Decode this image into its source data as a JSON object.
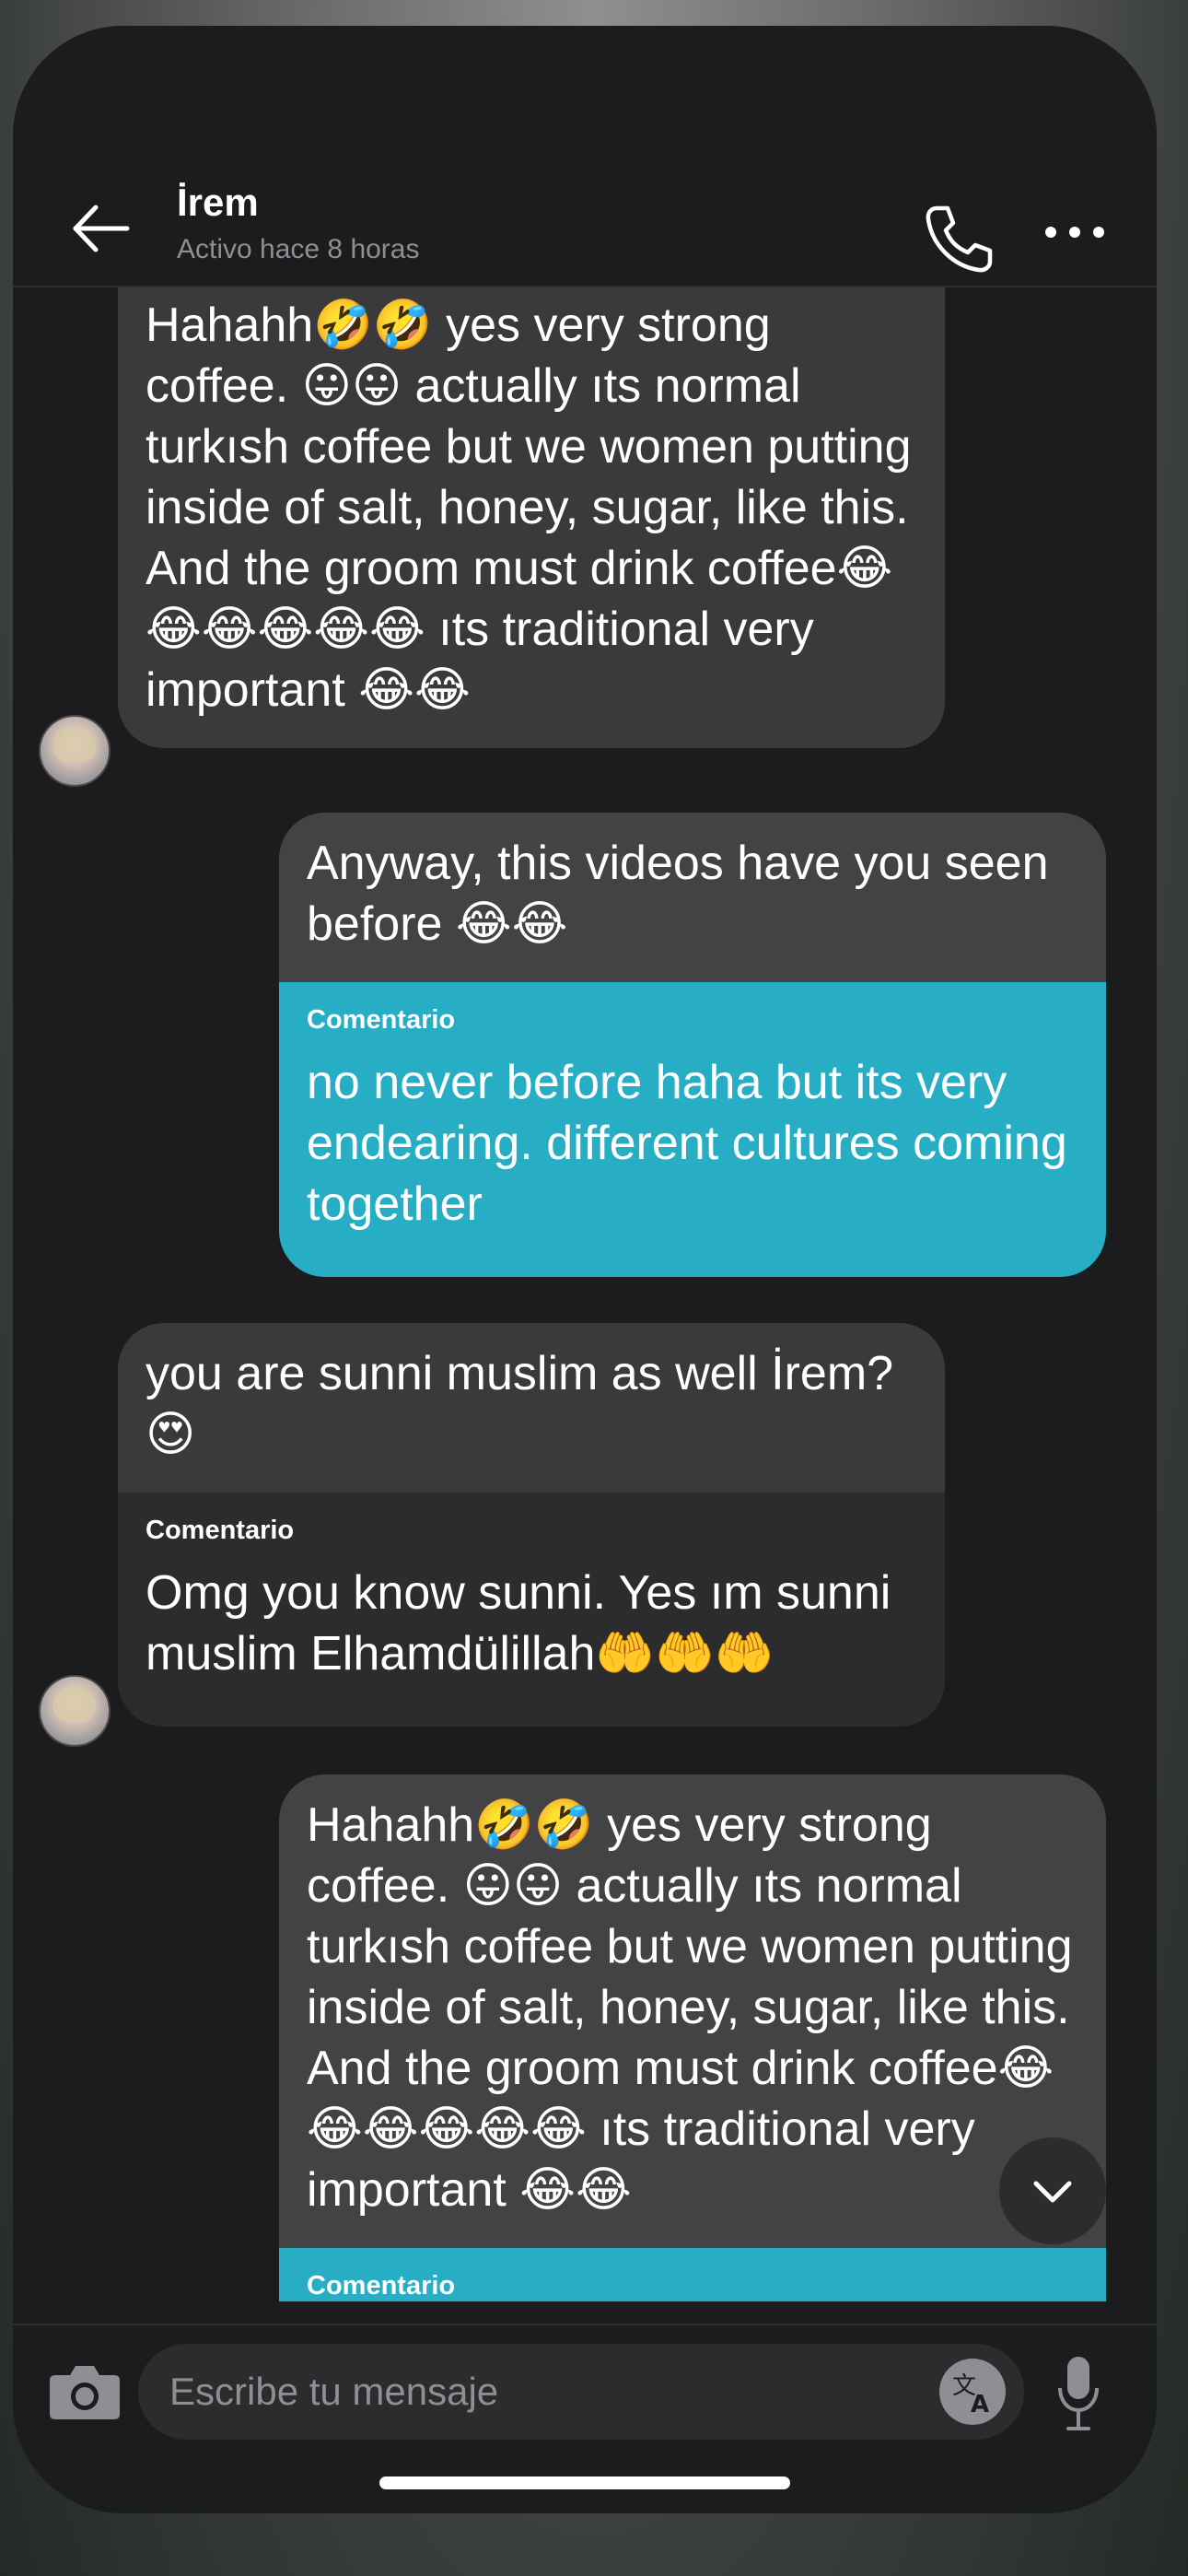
{
  "header": {
    "contact_name": "İrem",
    "status": "Activo hace 8 horas",
    "back_icon": "arrow-left-icon",
    "call_icon": "phone-icon",
    "more_icon": "more-dots-icon"
  },
  "messages": [
    {
      "direction": "received",
      "text": "Hahahh🤣🤣 yes very strong coffee. 😛😛 actually ıts normal turkısh coffee but we women putting inside of salt, honey, sugar, like this. And the groom must drink coffee😂😂😂😂😂😂 ıts traditional very important 😂😂"
    },
    {
      "direction": "sent",
      "text": "Anyway, this videos have you seen before 😂😂",
      "comment_label": "Comentario",
      "comment": "no never before haha but its very endearing. different cultures coming together"
    },
    {
      "direction": "received",
      "text": "you are sunni muslim as well İrem? 😍",
      "comment_label": "Comentario",
      "comment": "Omg you know sunni. Yes ım sunni muslim Elhamdülillah🤲🤲🤲"
    },
    {
      "direction": "sent",
      "text": "Hahahh🤣🤣 yes very strong coffee. 😛😛 actually ıts normal turkısh coffee but we women putting inside of salt, honey, sugar, like this. And the groom must drink coffee😂😂😂😂😂😂 ıts traditional very important 😂😂",
      "comment_label": "Comentario"
    }
  ],
  "input": {
    "placeholder": "Escribe tu mensaje",
    "camera_icon": "camera-icon",
    "translate_icon": "translate-icon",
    "mic_icon": "microphone-icon"
  },
  "colors": {
    "background": "#1c1c1e",
    "received_bubble": "#3a3a3c",
    "sent_bubble": "#434345",
    "comment_accent": "#27aec4",
    "text": "#ffffff",
    "muted_text": "#8e8e93"
  }
}
